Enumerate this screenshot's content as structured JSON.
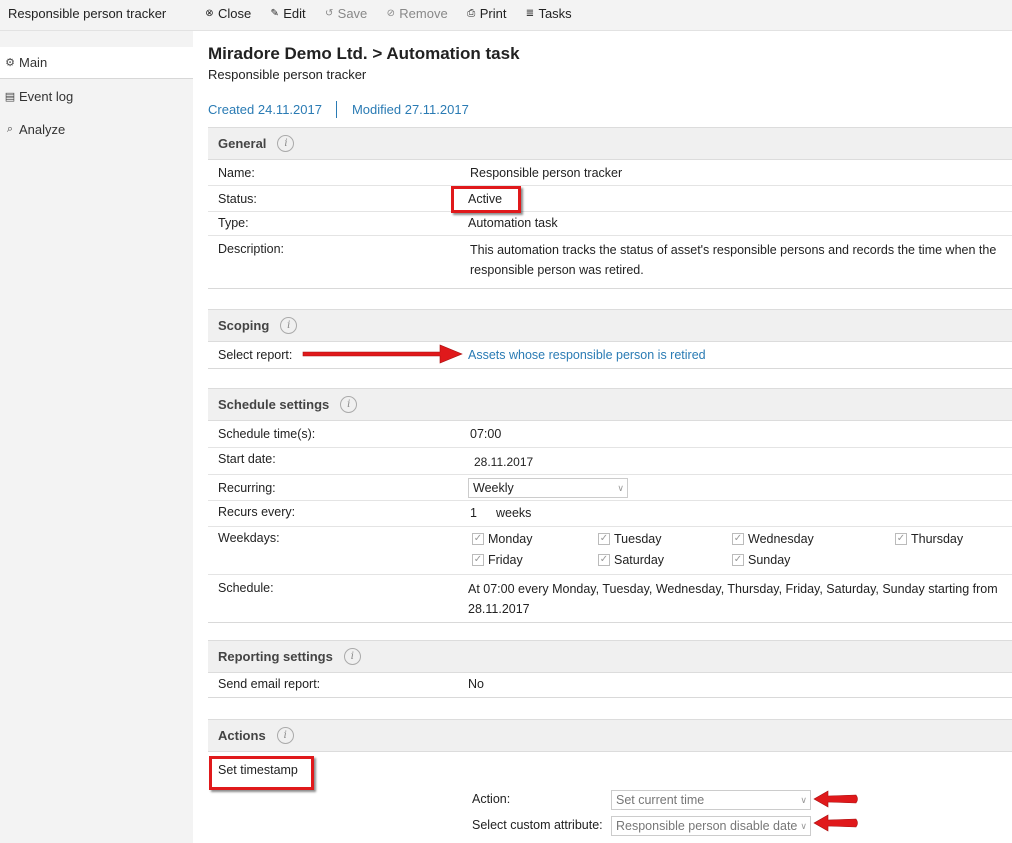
{
  "app_title": "Responsible person tracker",
  "toolbar": {
    "close": "Close",
    "edit": "Edit",
    "save": "Save",
    "remove": "Remove",
    "print": "Print",
    "tasks": "Tasks"
  },
  "sidebar": {
    "items": [
      {
        "label": "Main",
        "icon": "gears-icon"
      },
      {
        "label": "Event log",
        "icon": "event-log-icon"
      },
      {
        "label": "Analyze",
        "icon": "search-icon"
      }
    ]
  },
  "header": {
    "title": "Miradore Demo Ltd. > Automation task",
    "subtitle": "Responsible person tracker",
    "created": "Created 24.11.2017",
    "modified": "Modified 27.11.2017"
  },
  "general": {
    "title": "General",
    "info": "i",
    "name_label": "Name:",
    "name_value": "Responsible person tracker",
    "status_label": "Status:",
    "status_value": "Active",
    "type_label": "Type:",
    "type_value": "Automation task",
    "description_label": "Description:",
    "description_value": "This automation tracks the status of asset's responsible persons and records the time when the responsible person was retired."
  },
  "scoping": {
    "title": "Scoping",
    "info": "i",
    "report_label": "Select report:",
    "report_value": "Assets whose responsible person is retired"
  },
  "schedule": {
    "title": "Schedule settings",
    "info": "i",
    "times_label": "Schedule time(s):",
    "times_value": "07:00",
    "start_label": "Start date:",
    "start_value": "28.11.2017",
    "recurring_label": "Recurring:",
    "recurring_value": "Weekly",
    "recurs_label": "Recurs every:",
    "recurs_value": "1",
    "recurs_unit": "weeks",
    "weekdays_label": "Weekdays:",
    "weekdays": [
      "Monday",
      "Tuesday",
      "Wednesday",
      "Thursday",
      "Friday",
      "Saturday",
      "Sunday"
    ],
    "summary_label": "Schedule:",
    "summary_value": "At 07:00 every Monday, Tuesday, Wednesday, Thursday, Friday, Saturday, Sunday starting from 28.11.2017"
  },
  "reporting": {
    "title": "Reporting settings",
    "info": "i",
    "email_label": "Send email report:",
    "email_value": "No"
  },
  "actions": {
    "title": "Actions",
    "info": "i",
    "item_title": "Set timestamp",
    "action_label": "Action:",
    "action_value": "Set current time",
    "attr_label": "Select custom attribute:",
    "attr_value": "Responsible person disable date"
  },
  "colors": {
    "highlight": "#e0191b",
    "link": "#2a7bb4"
  }
}
